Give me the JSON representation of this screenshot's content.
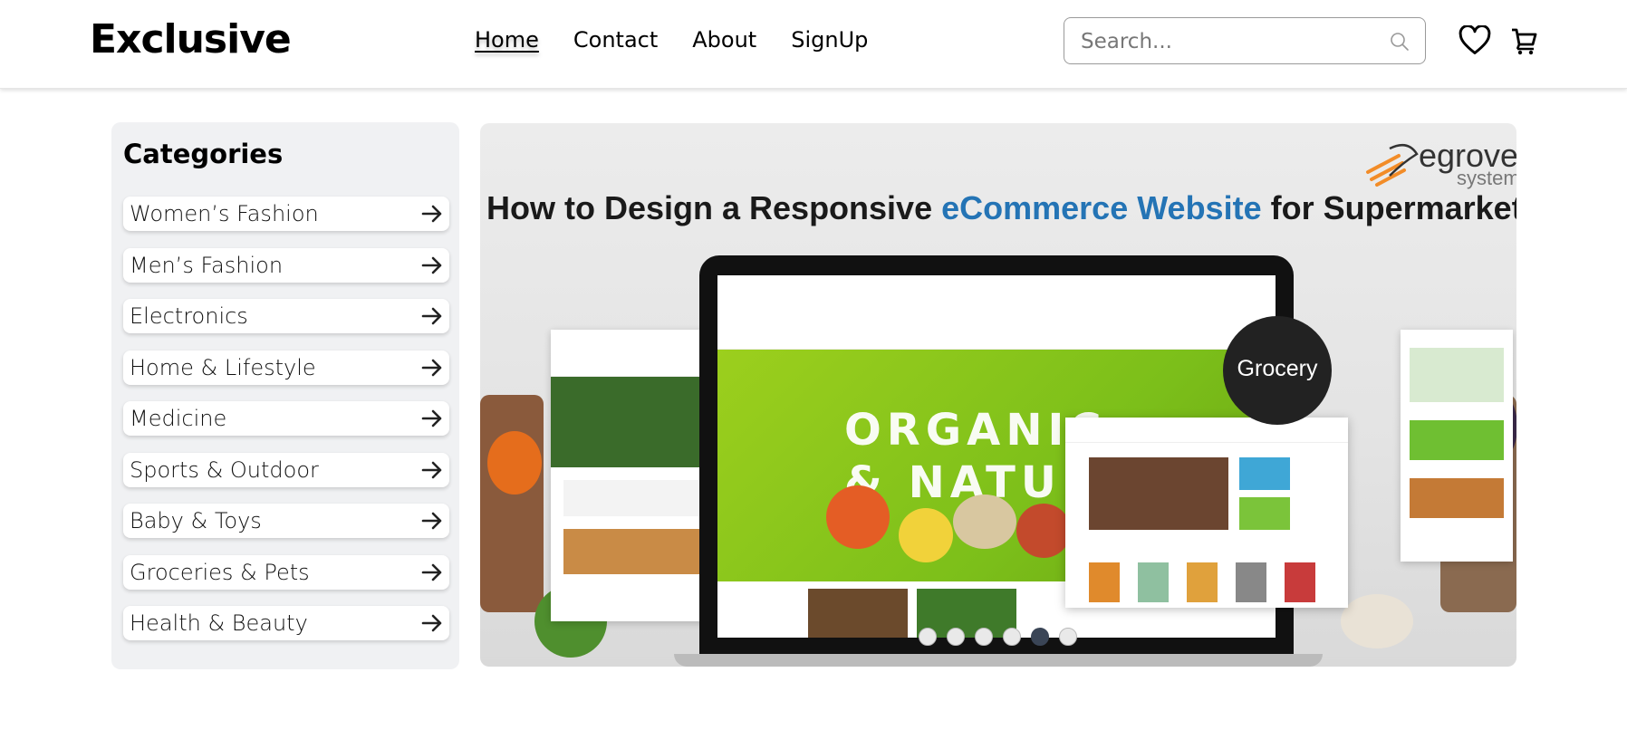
{
  "header": {
    "logo": "Exclusive",
    "nav": [
      {
        "label": "Home",
        "active": true
      },
      {
        "label": "Contact",
        "active": false
      },
      {
        "label": "About",
        "active": false
      },
      {
        "label": "SignUp",
        "active": false
      }
    ],
    "search": {
      "placeholder": "Search...",
      "value": ""
    },
    "icons": [
      "search-icon",
      "heart-icon",
      "cart-icon"
    ]
  },
  "categories": {
    "title": "Categories",
    "items": [
      {
        "label": "Women’s Fashion"
      },
      {
        "label": "Men’s Fashion"
      },
      {
        "label": "Electronics"
      },
      {
        "label": "Home & Lifestyle"
      },
      {
        "label": "Medicine"
      },
      {
        "label": "Sports & Outdoor"
      },
      {
        "label": "Baby & Toys"
      },
      {
        "label": "Groceries & Pets"
      },
      {
        "label": "Health & Beauty"
      }
    ]
  },
  "banner": {
    "title_pre": "How to Design a Responsive ",
    "title_highlight": "eCommerce Website",
    "title_post": " for Supermarkets?",
    "logo_text": "egrove",
    "logo_sub": "systems",
    "hero_line1": "ORGANIC",
    "hero_line2": "& NATURE",
    "badge": "Grocery",
    "highlight_color": "#2474b5",
    "slides_total": 6,
    "active_slide": 5
  }
}
